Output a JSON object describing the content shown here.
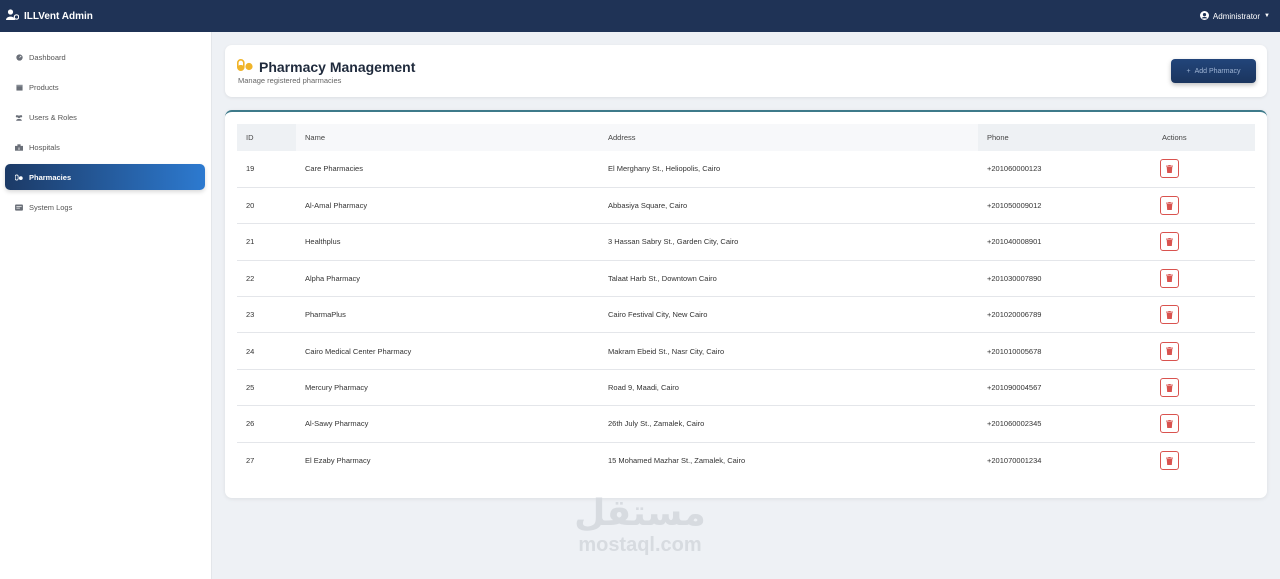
{
  "app": {
    "brand": "ILLVent Admin",
    "user": "Administrator"
  },
  "sidebar": {
    "items": [
      {
        "label": "Dashboard",
        "icon": "dashboard-icon"
      },
      {
        "label": "Products",
        "icon": "box-icon"
      },
      {
        "label": "Users & Roles",
        "icon": "users-icon"
      },
      {
        "label": "Hospitals",
        "icon": "hospital-icon"
      },
      {
        "label": "Pharmacies",
        "icon": "pills-icon",
        "active": true
      },
      {
        "label": "System Logs",
        "icon": "logs-icon"
      }
    ]
  },
  "page": {
    "title": "Pharmacy Management",
    "subtitle": "Manage registered pharmacies",
    "add_button": "Add Pharmacy",
    "add_button_icon": "plus-icon"
  },
  "table": {
    "columns": [
      "ID",
      "Name",
      "Address",
      "Phone",
      "Actions"
    ],
    "rows": [
      {
        "id": "19",
        "name": "Care Pharmacies",
        "address": "El Merghany St., Heliopolis, Cairo",
        "phone": "+201060000123"
      },
      {
        "id": "20",
        "name": "Al-Amal Pharmacy",
        "address": "Abbasiya Square, Cairo",
        "phone": "+201050009012"
      },
      {
        "id": "21",
        "name": "Healthplus",
        "address": "3 Hassan Sabry St., Garden City, Cairo",
        "phone": "+201040008901"
      },
      {
        "id": "22",
        "name": "Alpha Pharmacy",
        "address": "Talaat Harb St., Downtown Cairo",
        "phone": "+201030007890"
      },
      {
        "id": "23",
        "name": "PharmaPlus",
        "address": "Cairo Festival City, New Cairo",
        "phone": "+201020006789"
      },
      {
        "id": "24",
        "name": "Cairo Medical Center Pharmacy",
        "address": "Makram Ebeid St., Nasr City, Cairo",
        "phone": "+201010005678"
      },
      {
        "id": "25",
        "name": "Mercury Pharmacy",
        "address": "Road 9, Maadi, Cairo",
        "phone": "+201090004567"
      },
      {
        "id": "26",
        "name": "Al-Sawy Pharmacy",
        "address": "26th July St., Zamalek, Cairo",
        "phone": "+201060002345"
      },
      {
        "id": "27",
        "name": "El Ezaby Pharmacy",
        "address": "15 Mohamed Mazhar St., Zamalek, Cairo",
        "phone": "+201070001234"
      }
    ],
    "row_action_icon": "trash-icon"
  },
  "watermark": {
    "arabic": "مستقل",
    "latin": "mostaql.com"
  },
  "colors": {
    "navbar": "#1f3356",
    "active_nav_start": "#1c3a66",
    "active_nav_end": "#2d7ad0",
    "pills_icon": "#f0b429",
    "delete": "#d9534f"
  }
}
